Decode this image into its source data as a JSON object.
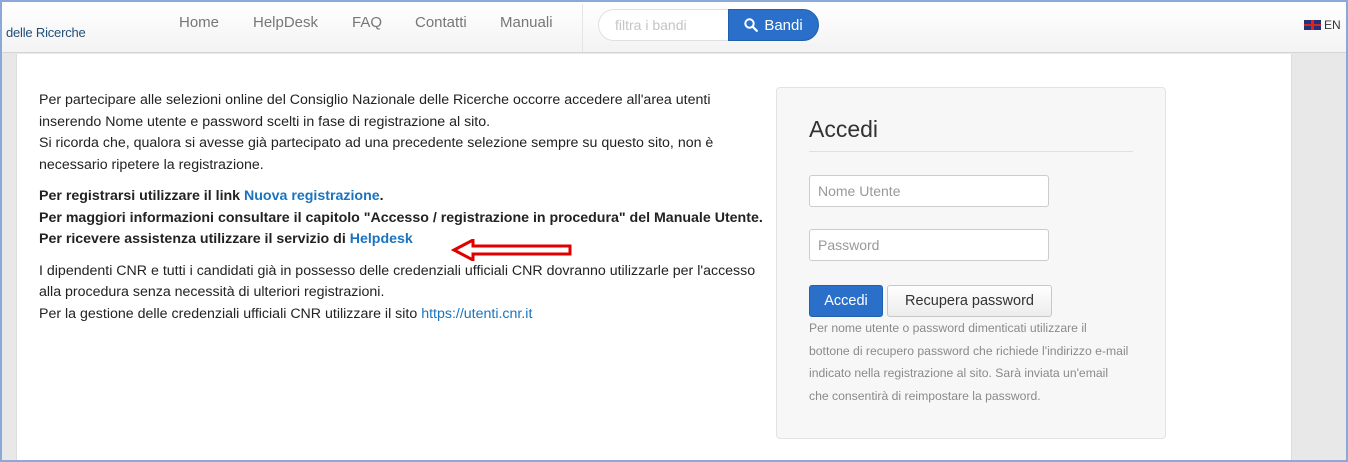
{
  "navbar": {
    "brand": "delle Ricerche",
    "links": [
      "Home",
      "HelpDesk",
      "FAQ",
      "Contatti",
      "Manuali"
    ],
    "search_placeholder": "filtra i bandi",
    "search_button": "Bandi",
    "lang": "EN"
  },
  "intro": {
    "p1": "Per partecipare alle selezioni online del Consiglio Nazionale delle Ricerche occorre accedere all'area utenti inserendo Nome utente e password scelti in fase di registrazione al sito.",
    "p1b": "Si ricorda che, qualora si avesse già partecipato ad una precedente selezione sempre su questo sito, non è necessario ripetere la registrazione.",
    "reg_prefix": "Per registrarsi utilizzare il link ",
    "reg_link": "Nuova registrazione",
    "reg_suffix": ".",
    "info": "Per maggiori informazioni consultare il capitolo \"Accesso / registrazione in procedura\" del Manuale Utente.",
    "help_prefix": "Per ricevere assistenza utilizzare il servizio di ",
    "help_link": "Helpdesk",
    "cnr1": "I dipendenti CNR e tutti i candidati già in possesso delle credenziali ufficiali CNR dovranno utilizzarle per l'accesso alla procedura senza necessità di ulteriori registrazioni.",
    "cnr2_prefix": "Per la gestione delle credenziali ufficiali CNR utilizzare il sito ",
    "cnr2_link": "https://utenti.cnr.it"
  },
  "login": {
    "title": "Accedi",
    "username_placeholder": "Nome Utente",
    "password_placeholder": "Password",
    "submit": "Accedi",
    "recover": "Recupera password",
    "help": "Per nome utente o password dimenticati utilizzare il bottone di recupero password che richiede l'indirizzo e-mail indicato nella registrazione al sito. Sarà inviata un'email che consentirà di reimpostare la password."
  },
  "colors": {
    "primary": "#2a6fc9",
    "link": "#1a73c0",
    "annotation_arrow": "#e00000"
  },
  "icons": [
    "search-icon",
    "uk-flag-icon",
    "red-arrow-annotation"
  ]
}
